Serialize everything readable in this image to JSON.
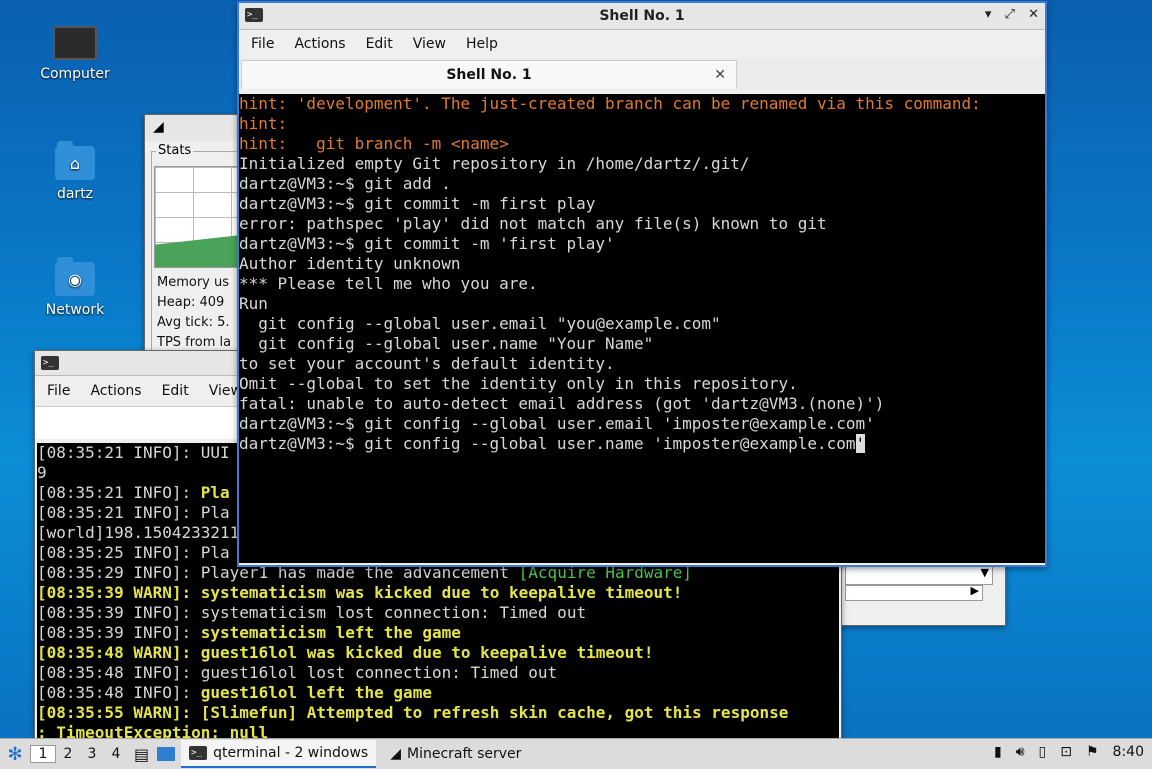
{
  "desktop": {
    "icons": [
      {
        "label": "Computer"
      },
      {
        "label": "dartz"
      },
      {
        "label": "Network"
      }
    ]
  },
  "stats_window": {
    "group_label": "Stats",
    "lines": [
      "Memory us",
      "Heap: 409",
      "Avg tick: 5.",
      "TPS from la"
    ]
  },
  "shell_window": {
    "title": "Shell No. 1",
    "menu": [
      "File",
      "Actions",
      "Edit",
      "View",
      "Help"
    ],
    "tab_label": "Shell No. 1",
    "lines": [
      "hint: 'development'. The just-created branch can be renamed via this command:",
      "hint:",
      "hint:   git branch -m <name>",
      "Initialized empty Git repository in /home/dartz/.git/",
      "dartz@VM3:~$ git add .",
      "dartz@VM3:~$ git commit -m first play",
      "error: pathspec 'play' did not match any file(s) known to git",
      "dartz@VM3:~$ git commit -m 'first play'",
      "Author identity unknown",
      "",
      "*** Please tell me who you are.",
      "",
      "Run",
      "",
      "  git config --global user.email \"you@example.com\"",
      "  git config --global user.name \"Your Name\"",
      "",
      "to set your account's default identity.",
      "Omit --global to set the identity only in this repository.",
      "",
      "fatal: unable to auto-detect email address (got 'dartz@VM3.(none)')",
      "dartz@VM3:~$ git config --global user.email 'imposter@example.com'",
      "dartz@VM3:~$ git config --global user.name 'imposter@example.com"
    ],
    "cursor_char": "'"
  },
  "server_window": {
    "menu": [
      "File",
      "Actions",
      "Edit",
      "View"
    ],
    "lines": [
      {
        "text": "[08:35:21 INFO]: UUI",
        "style": "normal"
      },
      {
        "text": "9",
        "style": "normal"
      },
      {
        "prefix": "[08:35:21 INFO]: ",
        "text": "Pla",
        "style": "yellow-tail"
      },
      {
        "prefix": "[08:35:21 INFO]: ",
        "text": "Pla",
        "style": "normal"
      },
      {
        "text": "[world]198.1504233211",
        "style": "normal"
      },
      {
        "prefix": "[08:35:25 INFO]: ",
        "text": "Pla",
        "style": "normal"
      },
      {
        "prefix": "[08:35:29 INFO]: ",
        "text": "Player1 has made the advancement ",
        "extra": "[Acquire Hardware]",
        "style": "green-tail"
      },
      {
        "text": "[08:35:39 WARN]: systematicism was kicked due to keepalive timeout!",
        "style": "yellow"
      },
      {
        "prefix": "[08:35:39 INFO]: ",
        "text": "systematicism lost connection: Timed out",
        "style": "normal"
      },
      {
        "prefix": "[08:35:39 INFO]: ",
        "text": "systematicism left the game",
        "style": "yellow-tail"
      },
      {
        "text": "[08:35:48 WARN]: guest16lol was kicked due to keepalive timeout!",
        "style": "yellow"
      },
      {
        "prefix": "[08:35:48 INFO]: ",
        "text": "guest16lol lost connection: Timed out",
        "style": "normal"
      },
      {
        "prefix": "[08:35:48 INFO]: ",
        "text": "guest16lol left the game",
        "style": "yellow-tail"
      },
      {
        "text": "[08:35:55 WARN]: [Slimefun] Attempted to refresh skin cache, got this response",
        "style": "yellow"
      },
      {
        "text": ": TimeoutException: null",
        "style": "yellow"
      }
    ]
  },
  "taskbar": {
    "workspaces": [
      "1",
      "2",
      "3",
      "4"
    ],
    "tasks": [
      {
        "label": "qterminal - 2 windows"
      },
      {
        "label": "Minecraft server"
      }
    ],
    "clock": "8:40"
  },
  "colors": {
    "terminal_bg": "#000000",
    "hint_orange": "#e07b2e",
    "warn_yellow": "#e5e54a",
    "advancement_green": "#4ec94e",
    "desktop_blue": "#0a78c8"
  }
}
